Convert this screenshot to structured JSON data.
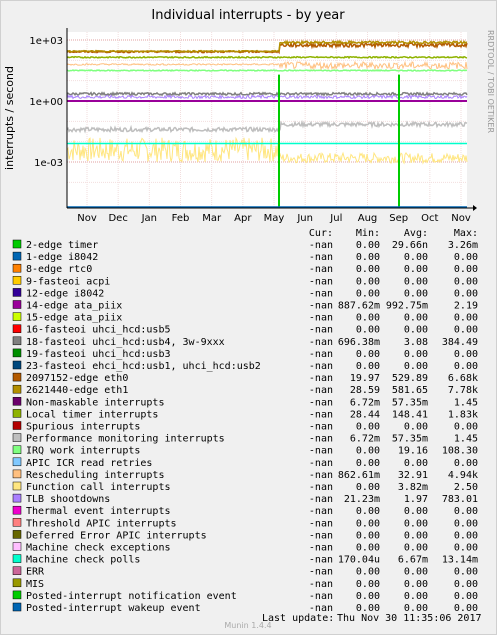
{
  "chart_data": {
    "type": "line",
    "title": "Individual interrupts - by year",
    "ylabel": "interrupts / second",
    "y_scale": "log",
    "y_ticks": [
      "1e-03",
      "1e+00",
      "1e+03"
    ],
    "x_ticks": [
      "Nov",
      "Dec",
      "Jan",
      "Feb",
      "Mar",
      "Apr",
      "May",
      "Jun",
      "Jul",
      "Aug",
      "Sep",
      "Oct",
      "Nov"
    ],
    "side_label": "RRDTOOL / TOBI OETIKER",
    "grid": true,
    "columns": [
      "Cur:",
      "Min:",
      "Avg:",
      "Max:"
    ],
    "series": [
      {
        "name": "2-edge      timer",
        "color": "#00cc00",
        "cur": "-nan",
        "min": "0.00",
        "avg": "29.66n",
        "max": "3.26m"
      },
      {
        "name": "1-edge      i8042",
        "color": "#0066b3",
        "cur": "-nan",
        "min": "0.00",
        "avg": "0.00",
        "max": "0.00"
      },
      {
        "name": "8-edge      rtc0",
        "color": "#ff8000",
        "cur": "-nan",
        "min": "0.00",
        "avg": "0.00",
        "max": "0.00"
      },
      {
        "name": "9-fasteoi   acpi",
        "color": "#ffcc00",
        "cur": "-nan",
        "min": "0.00",
        "avg": "0.00",
        "max": "0.00"
      },
      {
        "name": "12-edge      i8042",
        "color": "#330099",
        "cur": "-nan",
        "min": "0.00",
        "avg": "0.00",
        "max": "0.00"
      },
      {
        "name": "14-edge      ata_piix",
        "color": "#990099",
        "cur": "-nan",
        "min": "887.62m",
        "avg": "992.75m",
        "max": "2.19"
      },
      {
        "name": "15-edge      ata_piix",
        "color": "#ccff00",
        "cur": "-nan",
        "min": "0.00",
        "avg": "0.00",
        "max": "0.00"
      },
      {
        "name": "16-fasteoi   uhci_hcd:usb5",
        "color": "#ff0000",
        "cur": "-nan",
        "min": "0.00",
        "avg": "0.00",
        "max": "0.00"
      },
      {
        "name": "18-fasteoi   uhci_hcd:usb4, 3w-9xxx",
        "color": "#808080",
        "cur": "-nan",
        "min": "696.38m",
        "avg": "3.08",
        "max": "384.49"
      },
      {
        "name": "19-fasteoi   uhci_hcd:usb3",
        "color": "#008f00",
        "cur": "-nan",
        "min": "0.00",
        "avg": "0.00",
        "max": "0.00"
      },
      {
        "name": "23-fasteoi   ehci_hcd:usb1, uhci_hcd:usb2",
        "color": "#00487d",
        "cur": "-nan",
        "min": "0.00",
        "avg": "0.00",
        "max": "0.00"
      },
      {
        "name": "2097152-edge      eth0",
        "color": "#b35a00",
        "cur": "-nan",
        "min": "19.97",
        "avg": "529.89",
        "max": "6.68k"
      },
      {
        "name": "2621440-edge      eth1",
        "color": "#b38f00",
        "cur": "-nan",
        "min": "28.59",
        "avg": "581.65",
        "max": "7.78k"
      },
      {
        "name": "Non-maskable interrupts",
        "color": "#6b006b",
        "cur": "-nan",
        "min": "6.72m",
        "avg": "57.35m",
        "max": "1.45"
      },
      {
        "name": "Local timer interrupts",
        "color": "#8fb300",
        "cur": "-nan",
        "min": "28.44",
        "avg": "148.41",
        "max": "1.83k"
      },
      {
        "name": "Spurious interrupts",
        "color": "#b30000",
        "cur": "-nan",
        "min": "0.00",
        "avg": "0.00",
        "max": "0.00"
      },
      {
        "name": "Performance monitoring interrupts",
        "color": "#bebebe",
        "cur": "-nan",
        "min": "6.72m",
        "avg": "57.35m",
        "max": "1.45"
      },
      {
        "name": "IRQ work interrupts",
        "color": "#80ff80",
        "cur": "-nan",
        "min": "0.00",
        "avg": "19.16",
        "max": "108.30"
      },
      {
        "name": "APIC ICR read retries",
        "color": "#80c9ff",
        "cur": "-nan",
        "min": "0.00",
        "avg": "0.00",
        "max": "0.00"
      },
      {
        "name": "Rescheduling interrupts",
        "color": "#ffc080",
        "cur": "-nan",
        "min": "862.61m",
        "avg": "32.91",
        "max": "4.94k"
      },
      {
        "name": "Function call interrupts",
        "color": "#ffe680",
        "cur": "-nan",
        "min": "0.00",
        "avg": "3.82m",
        "max": "2.50"
      },
      {
        "name": "TLB shootdowns",
        "color": "#aa80ff",
        "cur": "-nan",
        "min": "21.23m",
        "avg": "1.97",
        "max": "783.01"
      },
      {
        "name": "Thermal event interrupts",
        "color": "#ee00cc",
        "cur": "-nan",
        "min": "0.00",
        "avg": "0.00",
        "max": "0.00"
      },
      {
        "name": "Threshold APIC interrupts",
        "color": "#ff8080",
        "cur": "-nan",
        "min": "0.00",
        "avg": "0.00",
        "max": "0.00"
      },
      {
        "name": "Deferred Error APIC interrupts",
        "color": "#666600",
        "cur": "-nan",
        "min": "0.00",
        "avg": "0.00",
        "max": "0.00"
      },
      {
        "name": "Machine check exceptions",
        "color": "#ffbfff",
        "cur": "-nan",
        "min": "0.00",
        "avg": "0.00",
        "max": "0.00"
      },
      {
        "name": "Machine check polls",
        "color": "#00ffcc",
        "cur": "-nan",
        "min": "170.04u",
        "avg": "6.67m",
        "max": "13.14m"
      },
      {
        "name": "ERR",
        "color": "#cc6699",
        "cur": "-nan",
        "min": "0.00",
        "avg": "0.00",
        "max": "0.00"
      },
      {
        "name": "MIS",
        "color": "#999900",
        "cur": "-nan",
        "min": "0.00",
        "avg": "0.00",
        "max": "0.00"
      },
      {
        "name": "Posted-interrupt notification event",
        "color": "#00cc00",
        "cur": "-nan",
        "min": "0.00",
        "avg": "0.00",
        "max": "0.00"
      },
      {
        "name": "Posted-interrupt wakeup event",
        "color": "#0066b3",
        "cur": "-nan",
        "min": "0.00",
        "avg": "0.00",
        "max": "0.00"
      }
    ],
    "last_update_label": "Last update:",
    "last_update": "Thu Nov 30 11:35:06 2017",
    "footer": "Munin 1.4.4"
  }
}
